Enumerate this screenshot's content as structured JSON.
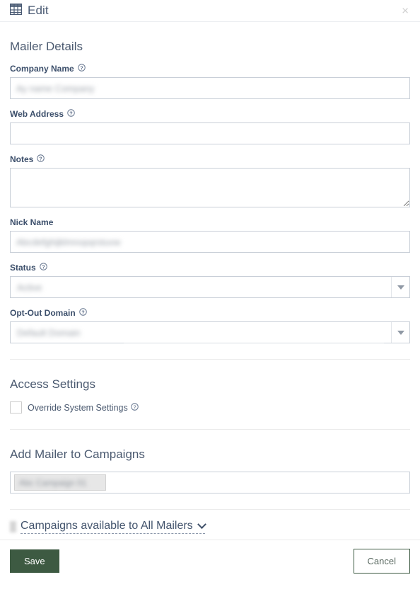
{
  "header": {
    "icon": "table-grid-icon",
    "title": "Edit",
    "close_label": "×"
  },
  "sections": {
    "mailer_details": {
      "title": "Mailer Details",
      "fields": {
        "company_name": {
          "label": "Company Name",
          "help_icon": "help-circle-icon",
          "value": "Ay name Company",
          "redacted": true
        },
        "web_address": {
          "label": "Web Address",
          "help_icon": "help-circle-icon",
          "value": "",
          "redacted": false
        },
        "notes": {
          "label": "Notes",
          "help_icon": "help-circle-icon",
          "value": "",
          "redacted": false
        },
        "nick_name": {
          "label": "Nick Name",
          "value": "Abcdefghijklmnopqrstuvw",
          "redacted": true
        },
        "status": {
          "label": "Status",
          "help_icon": "help-circle-icon",
          "value": "Active",
          "redacted": true
        },
        "opt_out_domain": {
          "label": "Opt-Out Domain",
          "help_icon": "help-circle-icon",
          "value": "Default Domain",
          "redacted": true
        }
      }
    },
    "access_settings": {
      "title": "Access Settings",
      "override": {
        "label": "Override System Settings",
        "help_icon": "help-circle-icon",
        "checked": false
      }
    },
    "add_mailer_to_campaigns": {
      "title": "Add Mailer to Campaigns",
      "tokens": [
        {
          "text": "Abc Campaign 01",
          "remove_icon": "close-icon",
          "redacted": true
        }
      ]
    },
    "campaigns_expander": {
      "label": "Campaigns available to All Mailers",
      "chevron_icon": "chevron-down-icon",
      "expanded": false
    }
  },
  "footer": {
    "save_label": "Save",
    "cancel_label": "Cancel"
  },
  "colors": {
    "accent_green": "#3d5a42",
    "heading_slate": "#4b5a70",
    "label_slate": "#3c4f6b",
    "border_gray": "#c9cfd8",
    "divider_gray": "#ececec"
  }
}
